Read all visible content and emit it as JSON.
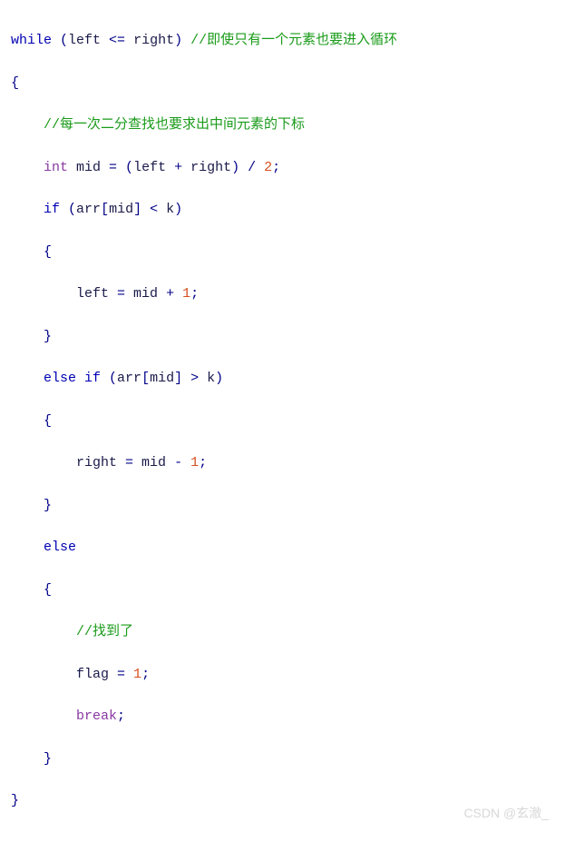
{
  "code": {
    "line1_while": "while",
    "line1_paren_open": " (",
    "line1_left": "left",
    "line1_le": " <= ",
    "line1_right": "right",
    "line1_paren_close": ") ",
    "line1_comment": "//即使只有一个元素也要进入循环",
    "line2_brace": "{",
    "line3_comment": "//每一次二分查找也要求出中间元素的下标",
    "line4_int": "int",
    "line4_mid": " mid ",
    "line4_eq": "= (",
    "line4_left": "left ",
    "line4_plus": "+ ",
    "line4_right": "right",
    "line4_pc": ") / ",
    "line4_two": "2",
    "line4_semi": ";",
    "line5_if": "if",
    "line5_open": " (",
    "line5_arr": "arr",
    "line5_br_open": "[",
    "line5_mid": "mid",
    "line5_br_close": "] ",
    "line5_lt": "< ",
    "line5_k": "k",
    "line5_close": ")",
    "line6_brace": "{",
    "line7_left": "left ",
    "line7_eq": "= ",
    "line7_mid": "mid ",
    "line7_plus": "+ ",
    "line7_one": "1",
    "line7_semi": ";",
    "line8_brace": "}",
    "line9_else_if": "else if",
    "line9_open": " (",
    "line9_arr": "arr",
    "line9_br_open": "[",
    "line9_mid": "mid",
    "line9_br_close": "] ",
    "line9_gt": "> ",
    "line9_k": "k",
    "line9_close": ")",
    "line10_brace": "{",
    "line11_right": "right ",
    "line11_eq": "= ",
    "line11_mid": "mid ",
    "line11_minus": "- ",
    "line11_one": "1",
    "line11_semi": ";",
    "line12_brace": "}",
    "line13_else": "else",
    "line14_brace": "{",
    "line15_comment": "//找到了",
    "line16_flag": "flag ",
    "line16_eq": "= ",
    "line16_one": "1",
    "line16_semi": ";",
    "line17_break": "break",
    "line17_semi": ";",
    "line18_brace": "}",
    "line19_brace": "}"
  },
  "watermark": "CSDN @玄澈_"
}
